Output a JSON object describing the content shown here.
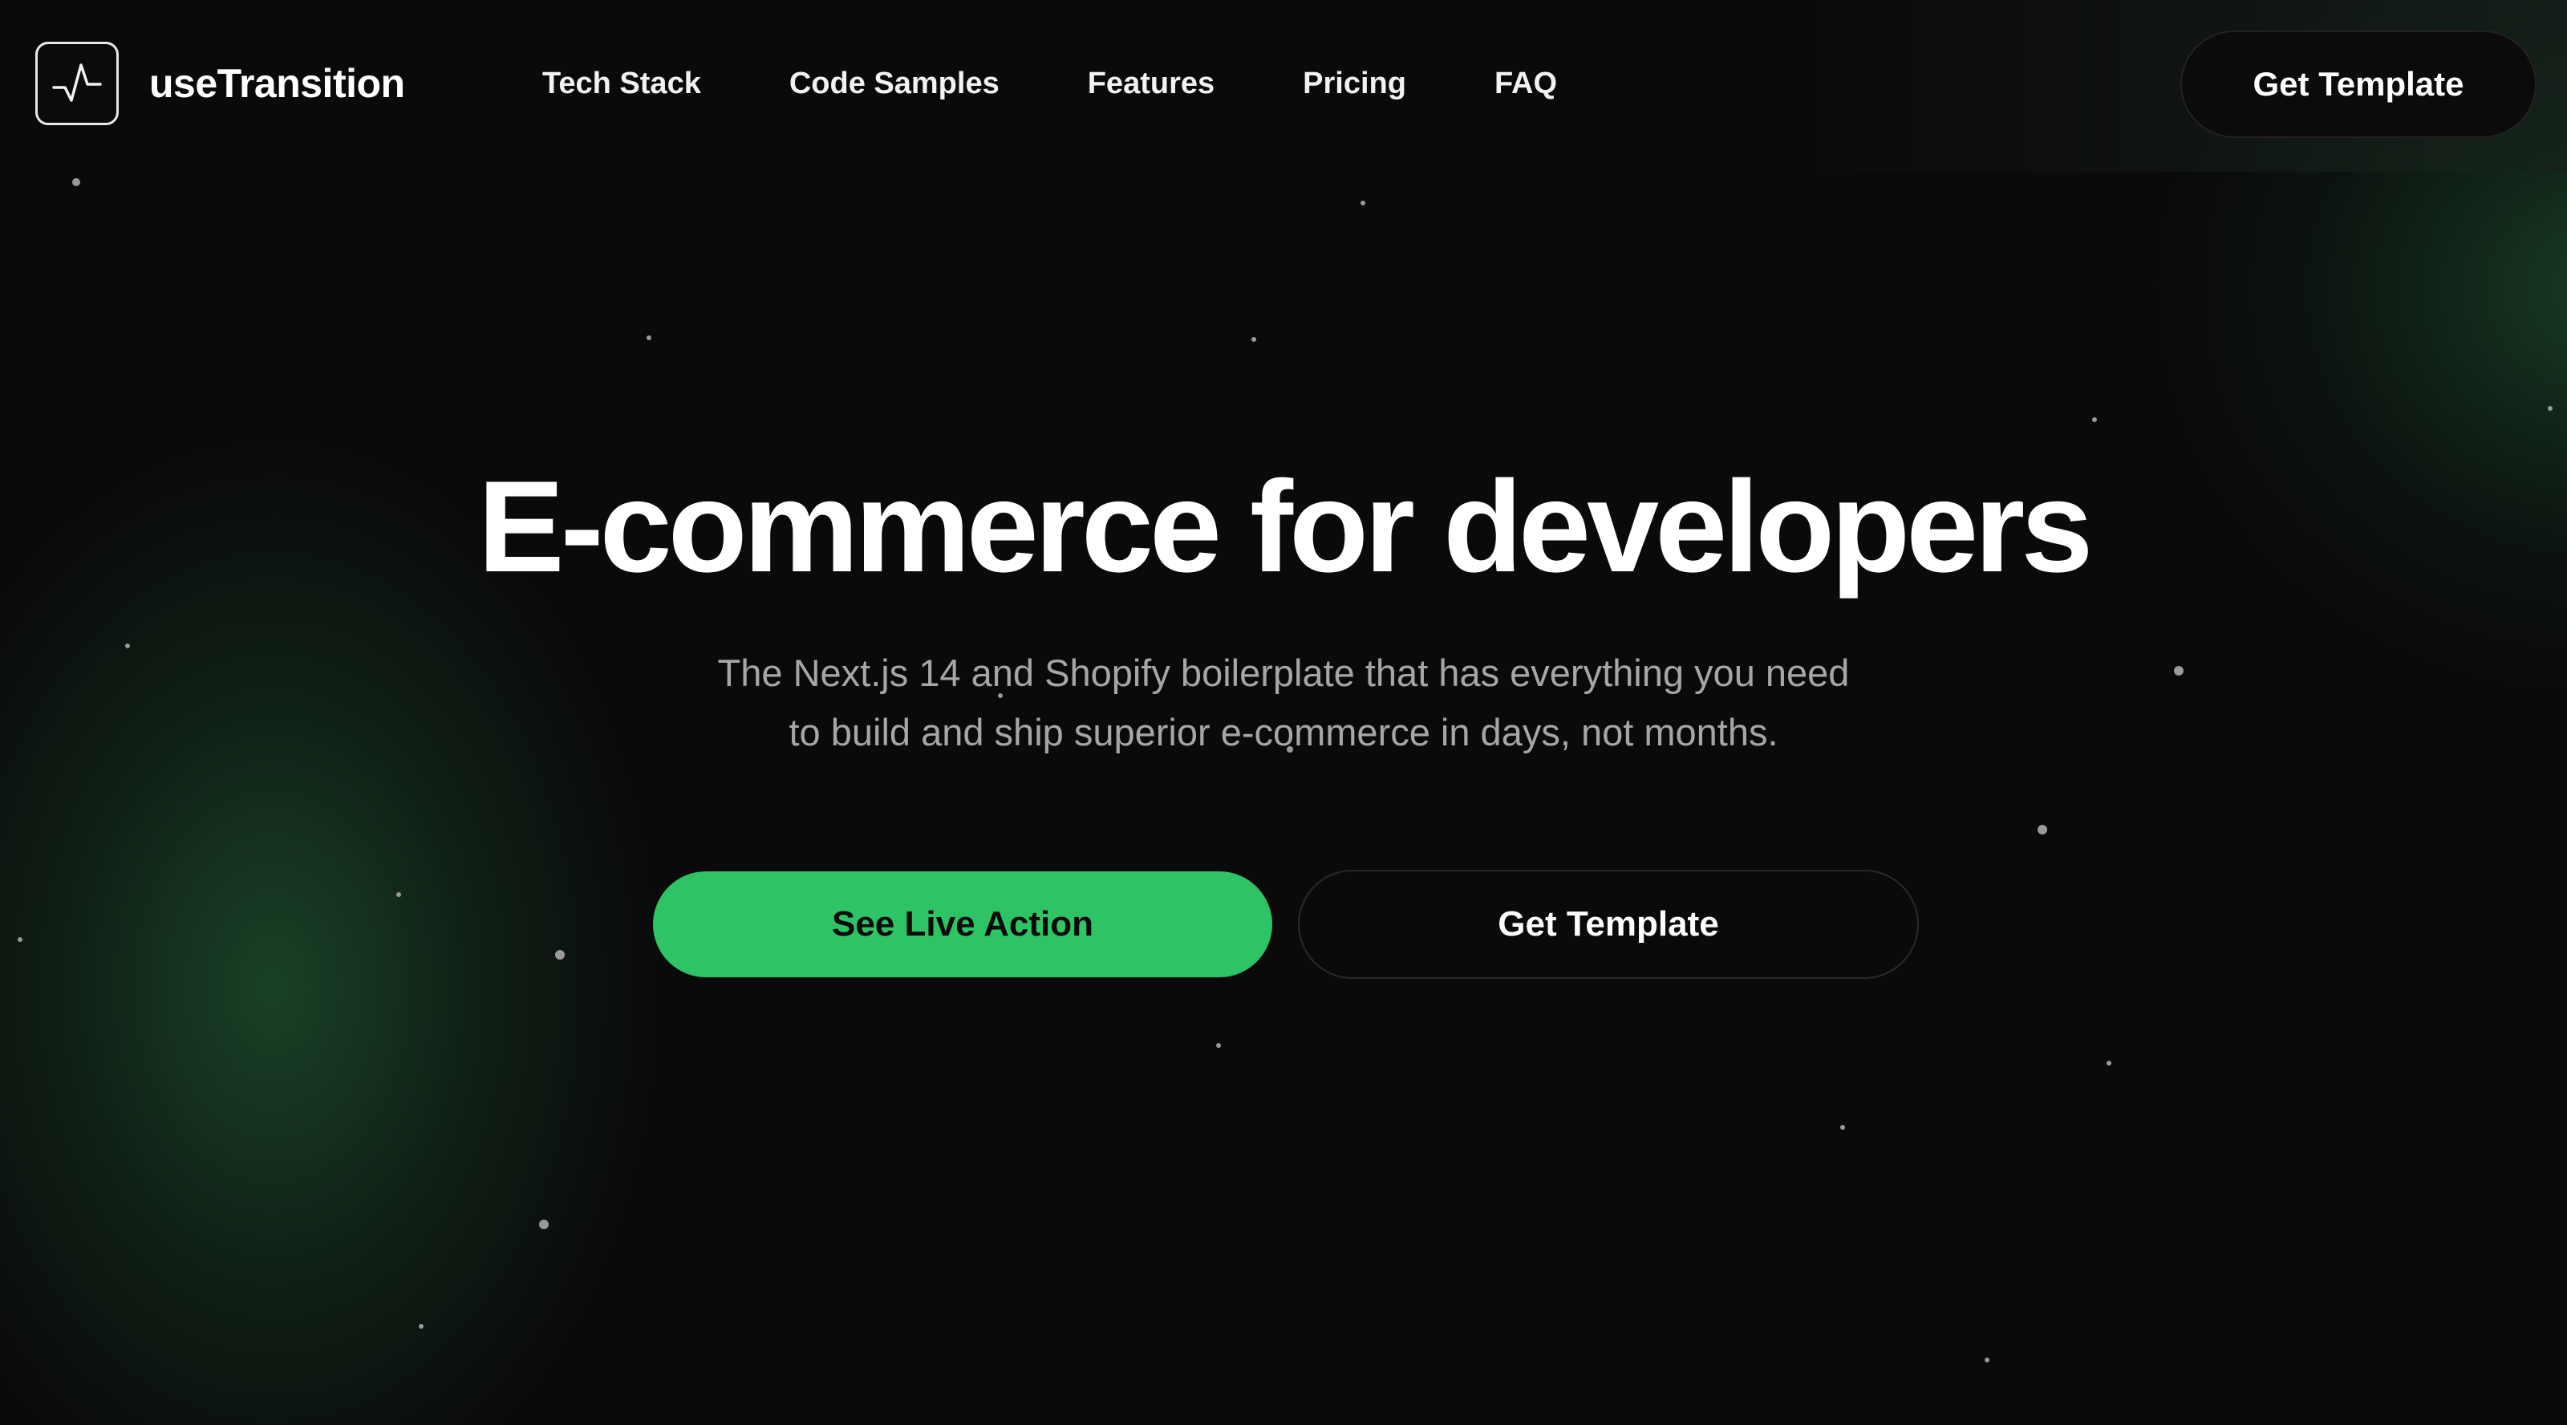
{
  "header": {
    "brand": "useTransition",
    "logo_icon": "pulse-icon",
    "nav": [
      {
        "label": "Tech Stack"
      },
      {
        "label": "Code Samples"
      },
      {
        "label": "Features"
      },
      {
        "label": "Pricing"
      },
      {
        "label": "FAQ"
      }
    ],
    "cta_label": "Get Template"
  },
  "hero": {
    "title": "E-commerce for developers",
    "subtitle_lines": [
      "The Next.js 14 and Shopify boilerplate that has everything you need",
      "to build and ship superior e-commerce in days, not months."
    ],
    "primary_button": "See Live Action",
    "secondary_button": "Get Template"
  },
  "colors": {
    "background": "#0a0a0a",
    "accent": "#2ec466",
    "text": "#ffffff",
    "muted_text": "#a6a6a6"
  }
}
